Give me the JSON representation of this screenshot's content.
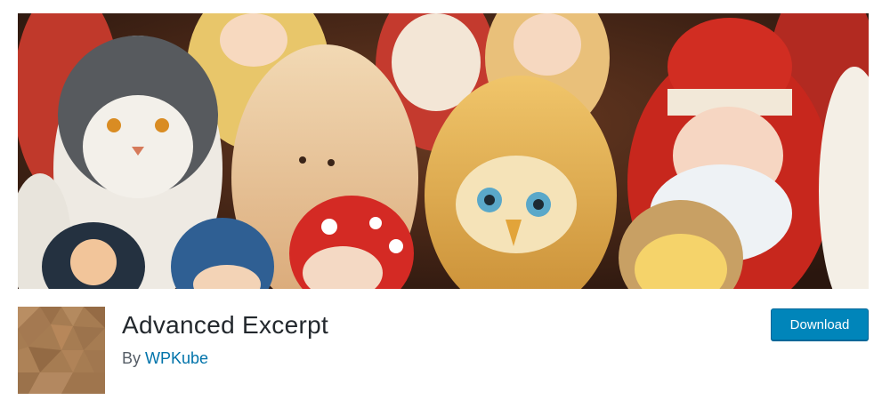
{
  "banner": {
    "alt": "Painted wooden nesting dolls: cat, owl, Santa Claus and other matryoshka figures"
  },
  "plugin": {
    "name": "Advanced Excerpt",
    "by_label": "By",
    "author": "WPKube",
    "download_label": "Download"
  },
  "colors": {
    "accent": "#0085ba",
    "link": "#0073aa",
    "icon_brown": "#a67c52"
  }
}
